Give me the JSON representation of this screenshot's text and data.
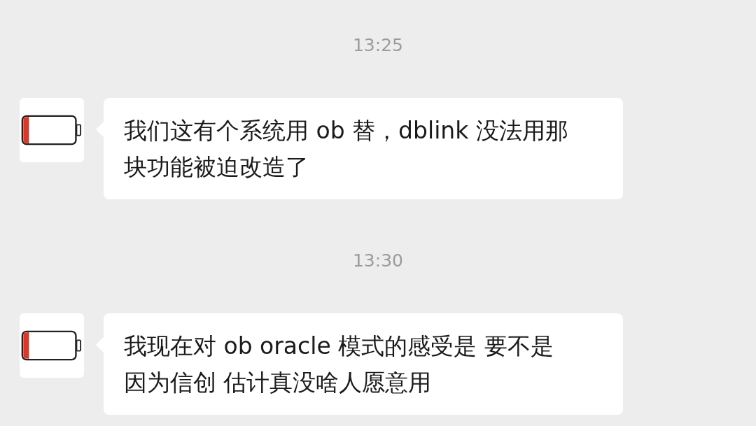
{
  "messages": [
    {
      "time": "13:25",
      "text": "我们这有个系统用 ob 替，dblink 没法用那块功能被迫改造了"
    },
    {
      "time": "13:30",
      "text": "我现在对 ob oracle 模式的感受是 要不是因为信创 估计真没啥人愿意用"
    }
  ]
}
